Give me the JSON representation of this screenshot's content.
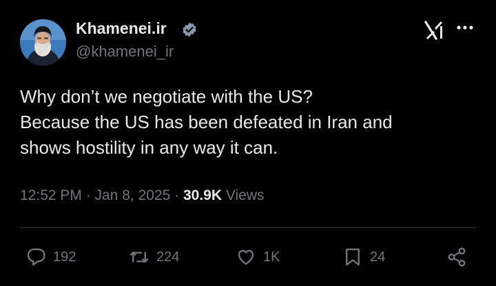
{
  "user": {
    "display_name": "Khamenei.ir",
    "handle": "@khamenei_ir",
    "verified": true
  },
  "tweet": {
    "lines": [
      "Why don’t we negotiate with the US?",
      "Because the US has been defeated in Iran and",
      "shows hostility in any way it can."
    ],
    "time": "12:52 PM · Jan 8, 2025 · ",
    "views_count": "30.9K",
    "views_label": " Views"
  },
  "actions": {
    "replies": "192",
    "reposts": "224",
    "likes": "1K",
    "bookmarks": "24"
  },
  "icons": {
    "verified": "verified-badge-icon",
    "logo": "x-logo-icon",
    "more": "more-icon",
    "reply": "reply-icon",
    "repost": "repost-icon",
    "like": "heart-icon",
    "bookmark": "bookmark-icon",
    "share": "share-icon"
  },
  "colors": {
    "background": "#000000",
    "text": "#e7e9ea",
    "muted": "#71767b",
    "verified": "#829aab",
    "divider": "#2f3336"
  }
}
